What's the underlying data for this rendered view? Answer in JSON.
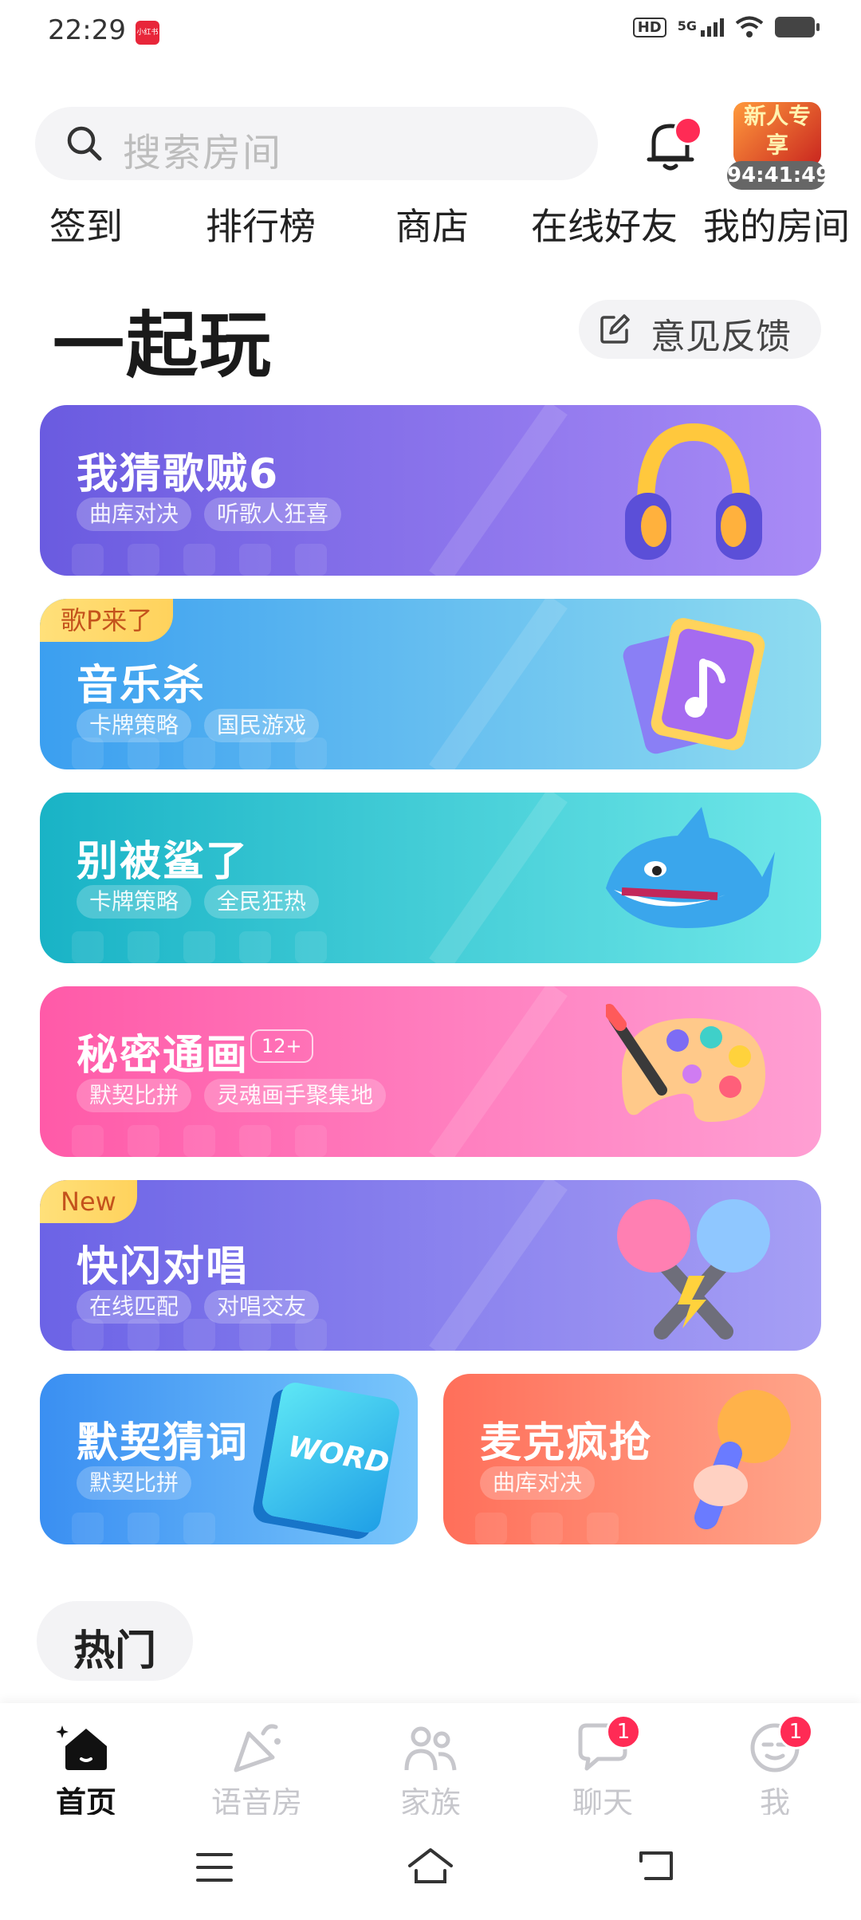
{
  "status_bar": {
    "time": "22:29",
    "app_badge": "小红书",
    "hd": "HD",
    "network": "5G"
  },
  "search": {
    "placeholder": "搜索房间"
  },
  "notification": {
    "dot": true
  },
  "promo": {
    "title": "新人专享",
    "countdown": "94:41:49"
  },
  "quick_links": [
    "签到",
    "排行榜",
    "商店",
    "在线好友",
    "我的房间"
  ],
  "section": {
    "title": "一起玩",
    "feedback_label": "意见反馈"
  },
  "games": [
    {
      "title": "我猜歌贼6",
      "tags": [
        "曲库对决",
        "听歌人狂喜"
      ],
      "badge": "",
      "age": "",
      "colors": [
        "#6a5be0",
        "#a98bf6"
      ]
    },
    {
      "title": "音乐杀",
      "tags": [
        "卡牌策略",
        "国民游戏"
      ],
      "badge": "歌P来了",
      "age": "",
      "colors": [
        "#3b9ff0",
        "#8fdcf0"
      ]
    },
    {
      "title": "别被鲨了",
      "tags": [
        "卡牌策略",
        "全民狂热"
      ],
      "badge": "",
      "age": "",
      "colors": [
        "#19b3c6",
        "#6fe7e8"
      ]
    },
    {
      "title": "秘密通画",
      "tags": [
        "默契比拼",
        "灵魂画手聚集地"
      ],
      "badge": "",
      "age": "12+",
      "colors": [
        "#ff5aa8",
        "#ff9fd3"
      ]
    },
    {
      "title": "快闪对唱",
      "tags": [
        "在线匹配",
        "对唱交友"
      ],
      "badge": "New",
      "age": "",
      "colors": [
        "#6c63e6",
        "#a69ff5"
      ]
    }
  ],
  "small_games": [
    {
      "title": "默契猜词",
      "tags": [
        "默契比拼"
      ],
      "art_text": "WORD",
      "colors": [
        "#3a8ff2",
        "#79c6fb"
      ]
    },
    {
      "title": "麦克疯抢",
      "tags": [
        "曲库对决"
      ],
      "art_text": "",
      "colors": [
        "#ff6f5a",
        "#ffa58a"
      ]
    }
  ],
  "hot": {
    "label": "热门"
  },
  "tabs": [
    {
      "label": "首页",
      "active": true,
      "badge": ""
    },
    {
      "label": "语音房",
      "active": false,
      "badge": ""
    },
    {
      "label": "家族",
      "active": false,
      "badge": ""
    },
    {
      "label": "聊天",
      "active": false,
      "badge": "1"
    },
    {
      "label": "我",
      "active": false,
      "badge": "1"
    }
  ]
}
